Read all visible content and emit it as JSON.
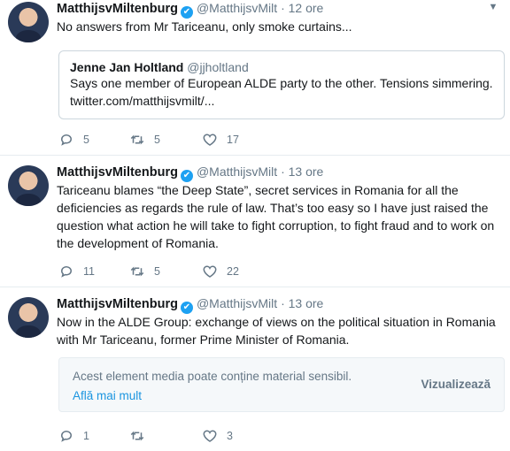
{
  "tweets": [
    {
      "name": "MatthijsvMiltenburg",
      "handle": "@MatthijsvMilt",
      "sep": "·",
      "time": "12 ore",
      "text": "No answers from Mr Tariceanu, only smoke curtains...",
      "quote": {
        "name": "Jenne Jan Holtland",
        "handle": "@jjholtland",
        "text": "Says one member of European ALDE party to the other. Tensions simmering. twitter.com/matthijsvmilt/..."
      },
      "replies": "5",
      "retweets": "5",
      "likes": "17"
    },
    {
      "name": "MatthijsvMiltenburg",
      "handle": "@MatthijsvMilt",
      "sep": "·",
      "time": "13 ore",
      "text": "Tariceanu blames “the Deep State”, secret services in Romania for all the deficiencies as regards the rule of law. That’s too easy so I have just raised the question what action he will take to fight corruption, to fight fraud and to work on the development of Romania.",
      "replies": "11",
      "retweets": "5",
      "likes": "22"
    },
    {
      "name": "MatthijsvMiltenburg",
      "handle": "@MatthijsvMilt",
      "sep": "·",
      "time": "13 ore",
      "text": "Now in the ALDE Group: exchange of views on the political situation in Romania with Mr Tariceanu, former Prime Minister of Romania.",
      "media_warning": {
        "text": "Acest element media poate conține material sensibil.",
        "link": "Află mai mult",
        "button": "Vizualizează"
      },
      "replies": "1",
      "retweets": "",
      "likes": "3"
    }
  ],
  "icons": {
    "verified": "verified-badge-icon",
    "chevron": "chevron-down-icon",
    "reply": "reply-icon",
    "retweet": "retweet-icon",
    "like": "heart-icon"
  },
  "colors": {
    "accent": "#1da1f2",
    "link": "#1b95e0",
    "muted": "#657786"
  }
}
